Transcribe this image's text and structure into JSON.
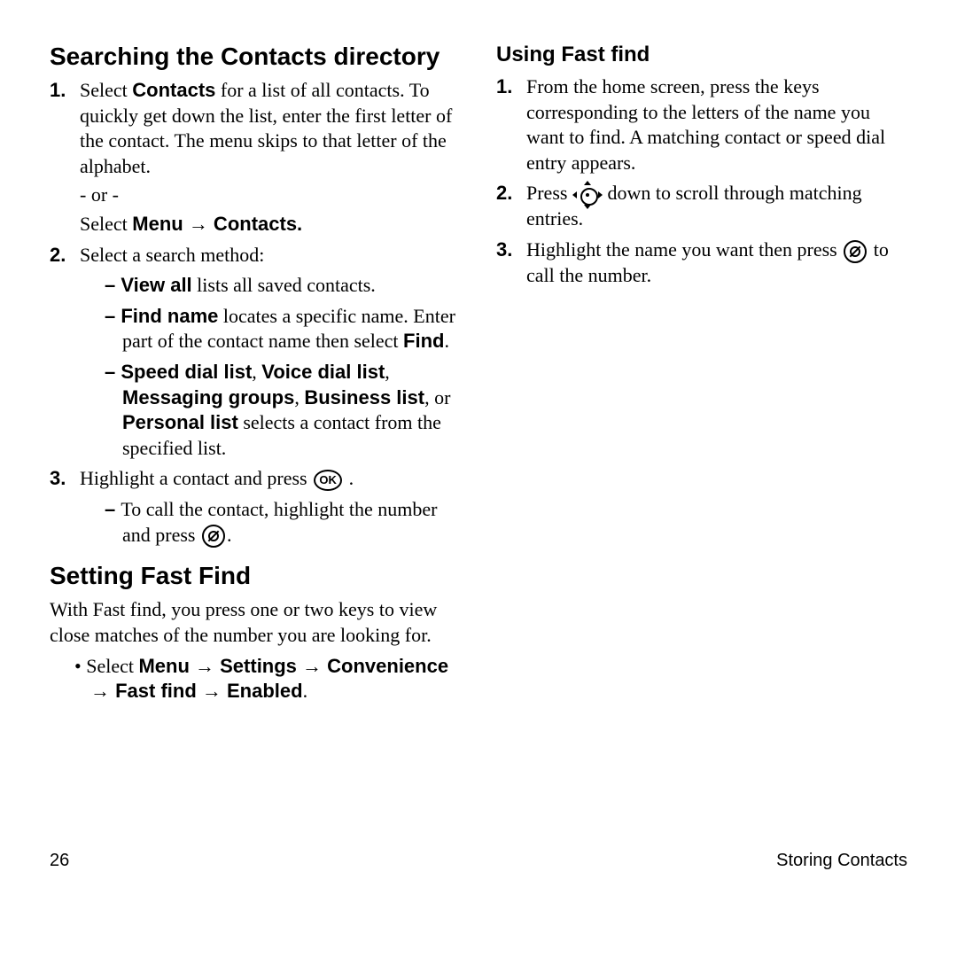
{
  "left": {
    "h1": "Searching the Contacts directory",
    "s1a": "Select ",
    "s1b": "Contacts",
    "s1c": " for a list of all contacts. To quickly get down the list, enter the first letter of the contact. The menu skips to that letter of the alphabet.",
    "or": "- or -",
    "s1d": "Select ",
    "s1e": "Menu → Contacts.",
    "s2": "Select a search method:",
    "s2a_b": "View all",
    "s2a_t": " lists all saved contacts.",
    "s2b_b": "Find name",
    "s2b_t": " locates a specific name. Enter part of the contact name then select ",
    "s2b_b2": "Find",
    "s2b_t2": ".",
    "s2c_b": "Speed dial list",
    "s2c_s1": ", ",
    "s2c_b2": "Voice dial list",
    "s2c_s2": ", ",
    "s2c_b3": "Messaging groups",
    "s2c_s3": ", ",
    "s2c_b4": "Business list",
    "s2c_s4": ", or ",
    "s2c_b5": "Personal list",
    "s2c_t": " selects a contact from the specified list.",
    "s3a": "Highlight a contact and press ",
    "ok": "OK",
    "s3a2": " .",
    "s3b": "To call the contact, highlight the number and press ",
    "h2": "Setting Fast Find",
    "p2": "With Fast find, you press one or two keys to view close matches of the number you are looking for.",
    "b1a": "Select ",
    "b1b": "Menu → Settings → Convenience → Fast find → Enabled",
    "b1c": "."
  },
  "right": {
    "h1": "Using Fast find",
    "s1": "From the home screen, press the keys corresponding to the letters of the name you want to find. A matching contact or speed dial entry appears.",
    "s2a": "Press ",
    "s2b": " down to scroll through matching entries.",
    "s3a": "Highlight the name you want then press ",
    "s3b": " to call the number."
  },
  "footer": {
    "page": "26",
    "section": "Storing Contacts"
  }
}
